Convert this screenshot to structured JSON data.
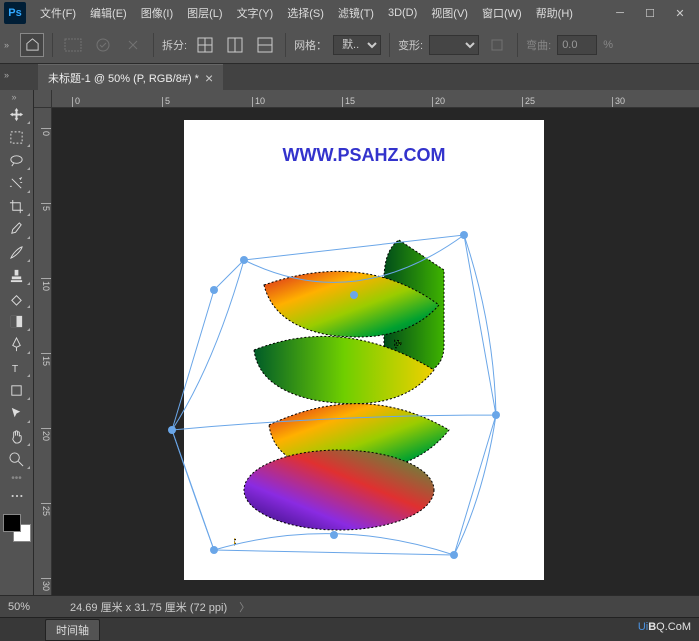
{
  "logo": "Ps",
  "menu": [
    "文件(F)",
    "编辑(E)",
    "图像(I)",
    "图层(L)",
    "文字(Y)",
    "选择(S)",
    "滤镜(T)",
    "3D(D)",
    "视图(V)",
    "窗口(W)",
    "帮助(H)"
  ],
  "optbar": {
    "split_label": "拆分:",
    "grid_label": "网格：",
    "grid_value": "默..",
    "warp_label": "变形:",
    "warp_value": "",
    "bend_label": "弯曲:",
    "bend_value": "0.0",
    "bend_unit": "%"
  },
  "tab": {
    "title": "未标题-1 @ 50% (P, RGB/8#) *"
  },
  "ruler_h": [
    0,
    5,
    10,
    15,
    20,
    25,
    30
  ],
  "ruler_v": [
    0,
    5,
    10,
    15,
    20,
    25,
    30
  ],
  "canvas": {
    "watermark": "WWW.PSAHZ.COM"
  },
  "status": {
    "zoom": "50%",
    "dims": "24.69 厘米 x 31.75 厘米 (72 ppi)"
  },
  "bottom": {
    "timeline": "时间轴"
  },
  "watermark": {
    "pre": "Ui",
    "mid": "B",
    "post": "Q.CoM"
  }
}
